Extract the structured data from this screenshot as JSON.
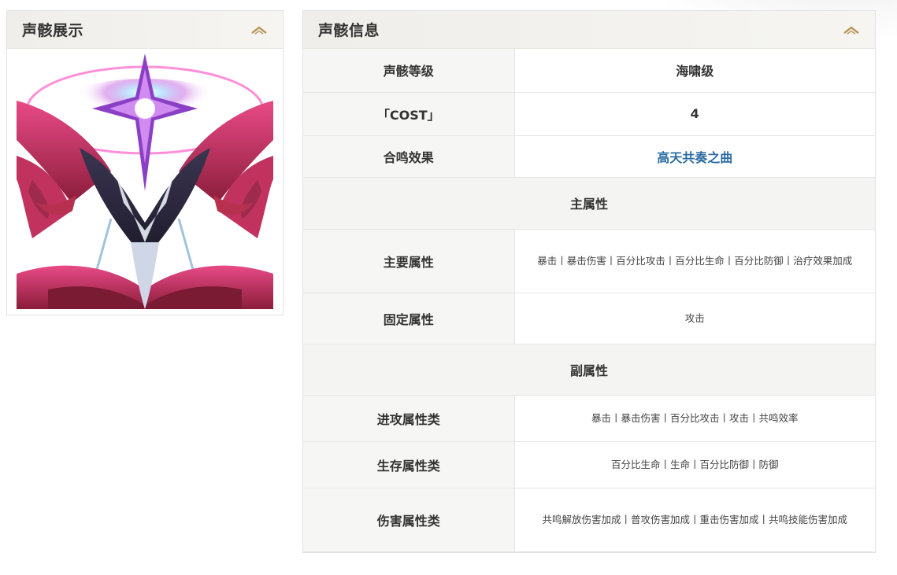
{
  "showcase": {
    "title": "声骸展示",
    "collapse_icon": "chevron-up-icon",
    "image_alt": "声骸立绘"
  },
  "info": {
    "title": "声骸信息",
    "collapse_icon": "chevron-up-icon",
    "rows": {
      "level": {
        "label": "声骸等级",
        "value": "海啸级"
      },
      "cost": {
        "label": "「COST」",
        "value": "4"
      },
      "sonata": {
        "label": "合鸣效果",
        "value": "高天共奏之曲"
      },
      "main_section": "主属性",
      "main_attr": {
        "label": "主要属性",
        "value": "暴击丨暴击伤害丨百分比攻击丨百分比生命丨百分比防御丨治疗效果加成"
      },
      "fixed_attr": {
        "label": "固定属性",
        "value": "攻击"
      },
      "sub_section": "副属性",
      "offense": {
        "label": "进攻属性类",
        "value": "暴击丨暴击伤害丨百分比攻击丨攻击丨共鸣效率"
      },
      "survival": {
        "label": "生存属性类",
        "value": "百分比生命丨生命丨百分比防御丨防御"
      },
      "damage": {
        "label": "伤害属性类",
        "value": "共鸣解放伤害加成丨普攻伤害加成丨重击伤害加成丨共鸣技能伤害加成"
      }
    }
  },
  "colors": {
    "accent": "#b8975a",
    "link": "#2c6ca3",
    "header_bg": "#f0efeb",
    "label_bg": "#f6f6f4"
  }
}
